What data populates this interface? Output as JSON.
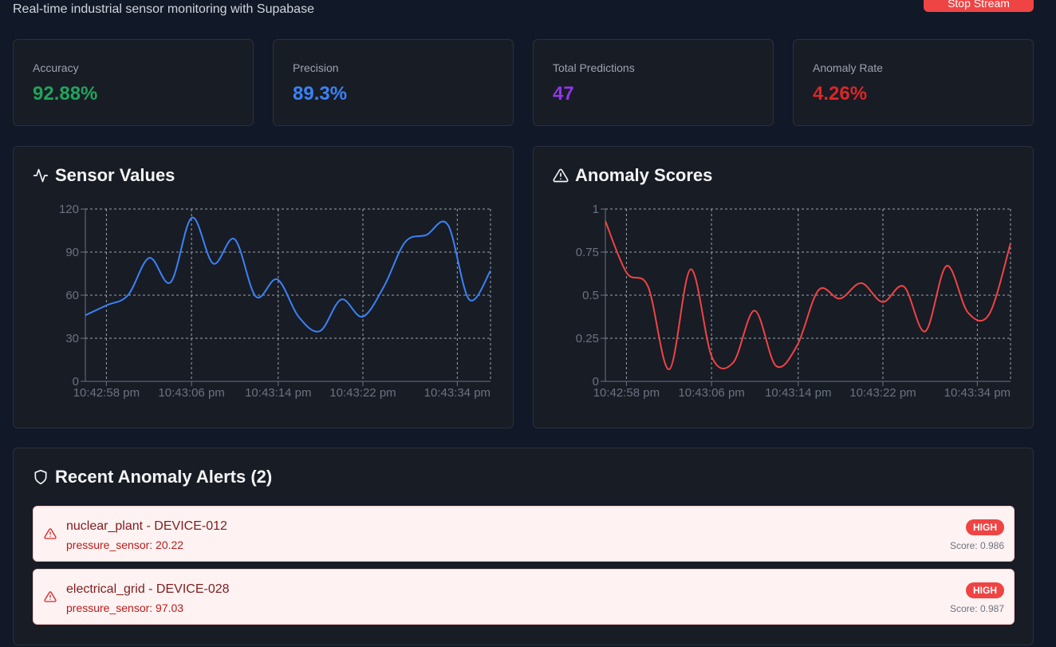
{
  "header": {
    "subtitle": "Real-time industrial sensor monitoring with Supabase",
    "stop_button_label": "Stop Stream"
  },
  "stats": [
    {
      "label": "Accuracy",
      "value": "92.88%",
      "color": "#22a35a"
    },
    {
      "label": "Precision",
      "value": "89.3%",
      "color": "#3b82f6"
    },
    {
      "label": "Total Predictions",
      "value": "47",
      "color": "#9333ea"
    },
    {
      "label": "Anomaly Rate",
      "value": "4.26%",
      "color": "#dc2626"
    }
  ],
  "charts": {
    "sensor_title": "Sensor Values",
    "anomaly_title": "Anomaly Scores"
  },
  "chart_data": [
    {
      "type": "line",
      "title": "Sensor Values",
      "x_ticks": [
        "10:42:58 pm",
        "10:43:06 pm",
        "10:43:14 pm",
        "10:43:22 pm",
        "10:43:34 pm"
      ],
      "y_ticks": [
        "0",
        "30",
        "60",
        "90",
        "120"
      ],
      "ylim": [
        0,
        120
      ],
      "grid": true,
      "color": "#3b82f6",
      "series": [
        {
          "values": [
            46,
            53,
            60,
            86,
            69,
            114,
            82,
            99,
            59,
            71,
            45,
            35,
            57,
            45,
            66,
            97,
            102,
            109,
            57,
            77
          ]
        }
      ]
    },
    {
      "type": "line",
      "title": "Anomaly Scores",
      "x_ticks": [
        "10:42:58 pm",
        "10:43:06 pm",
        "10:43:14 pm",
        "10:43:22 pm",
        "10:43:34 pm"
      ],
      "y_ticks": [
        "0",
        "0.25",
        "0.5",
        "0.75",
        "1"
      ],
      "ylim": [
        0,
        1
      ],
      "grid": true,
      "color": "#ef4444",
      "series": [
        {
          "values": [
            0.93,
            0.63,
            0.55,
            0.07,
            0.65,
            0.14,
            0.11,
            0.41,
            0.09,
            0.21,
            0.53,
            0.48,
            0.57,
            0.46,
            0.55,
            0.29,
            0.67,
            0.4,
            0.39,
            0.8
          ]
        }
      ]
    }
  ],
  "alerts": {
    "title": "Recent Anomaly Alerts (2)",
    "items": [
      {
        "name": "nuclear_plant - DEVICE-012",
        "detail": "pressure_sensor: 20.22",
        "severity": "HIGH",
        "score": "Score: 0.986"
      },
      {
        "name": "electrical_grid - DEVICE-028",
        "detail": "pressure_sensor: 97.03",
        "severity": "HIGH",
        "score": "Score: 0.987"
      }
    ]
  }
}
